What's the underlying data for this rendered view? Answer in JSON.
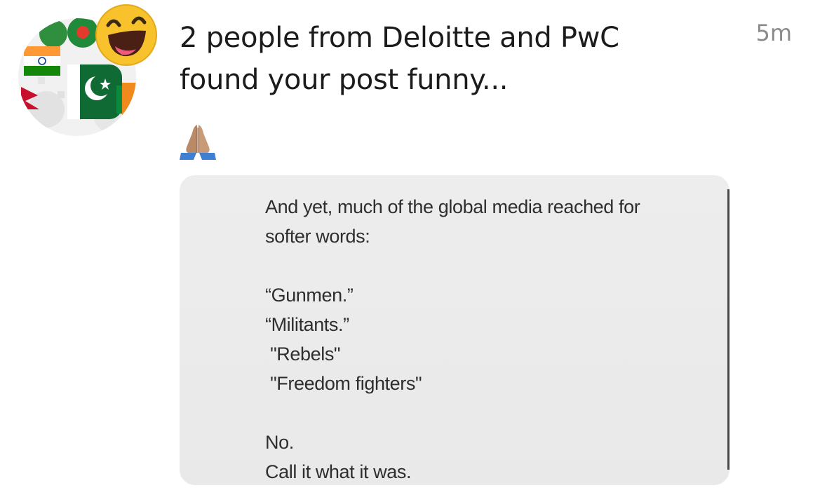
{
  "notification": {
    "title_line1": "2 people from Deloitte and PwC",
    "title_line2": "found your post funny...",
    "timestamp": "5m",
    "reaction": "funny-reaction-icon",
    "comment_emoji": "folded-hands-icon",
    "avatar": "flags-gears-avatar"
  },
  "post": {
    "paragraph1_line1": "And yet, much of the global media reached for",
    "paragraph1_line2": "softer words:",
    "quotes": [
      "“Gunmen.”",
      "“Militants.”",
      " \"Rebels\"",
      " \"Freedom fighters\""
    ],
    "closing_line1": "No.",
    "closing_line2": "Call it what it was."
  },
  "colors": {
    "title": "#1b1b1b",
    "timestamp": "#8a8a8a",
    "card_bg": "#ececec",
    "post_text": "#2e2e2e",
    "reaction_yellow": "#f7c22c"
  }
}
